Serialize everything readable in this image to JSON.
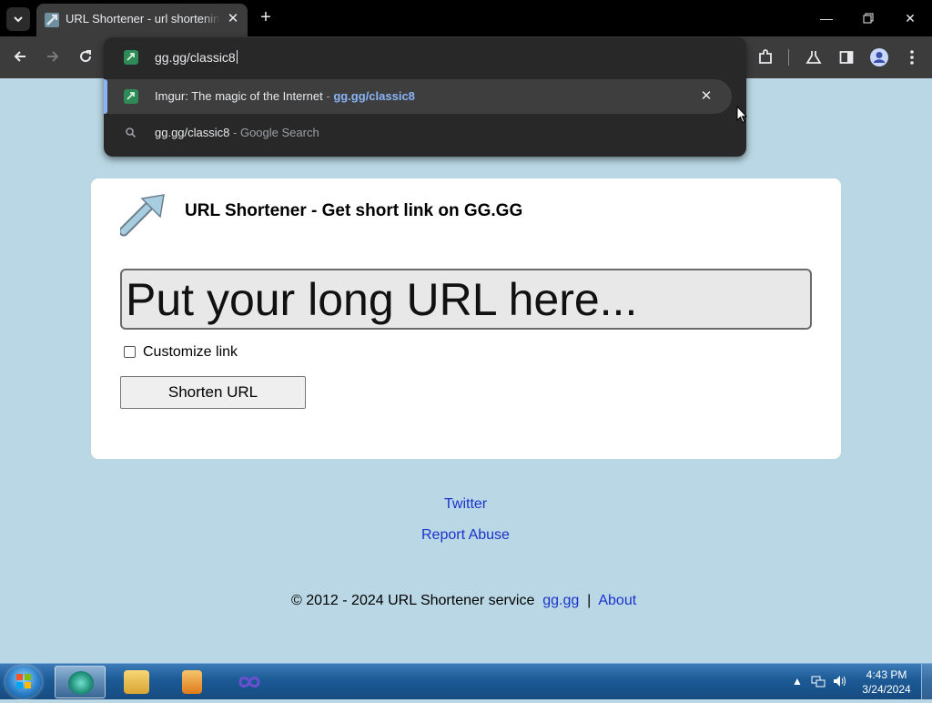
{
  "browser": {
    "tab_title": "URL Shortener - url shortening service",
    "address_text": "gg.gg/classic8",
    "suggestions": [
      {
        "title": "Imgur: The magic of the Internet",
        "separator": " - ",
        "url": "gg.gg/classic8"
      },
      {
        "title": "gg.gg/classic8",
        "separator": " - ",
        "suffix": "Google Search"
      }
    ],
    "icons": {
      "tab_search": "chevron-down-icon",
      "tab_close": "close-icon",
      "new_tab": "plus-icon",
      "back": "back-arrow-icon",
      "forward": "forward-arrow-icon",
      "reload": "reload-icon",
      "extensions": "puzzle-icon",
      "labs": "flask-icon",
      "side_panel": "side-panel-icon",
      "profile": "profile-icon",
      "menu": "kebab-menu-icon"
    },
    "accent_color": "#8ab4f8"
  },
  "page": {
    "heading": "URL Shortener - Get short link on GG.GG",
    "url_input_placeholder": "Put your long URL here...",
    "customize_label": "Customize link",
    "shorten_button": "Shorten URL",
    "links": {
      "twitter": "Twitter",
      "report_abuse": "Report Abuse"
    },
    "footer": {
      "text": "© 2012 - 2024 URL Shortener service",
      "site_link": "gg.gg",
      "separator": "|",
      "about_link": "About"
    },
    "background_color": "#b9d7e4",
    "link_color": "#1a33cc"
  },
  "taskbar": {
    "time": "4:43 PM",
    "date": "3/24/2024"
  }
}
